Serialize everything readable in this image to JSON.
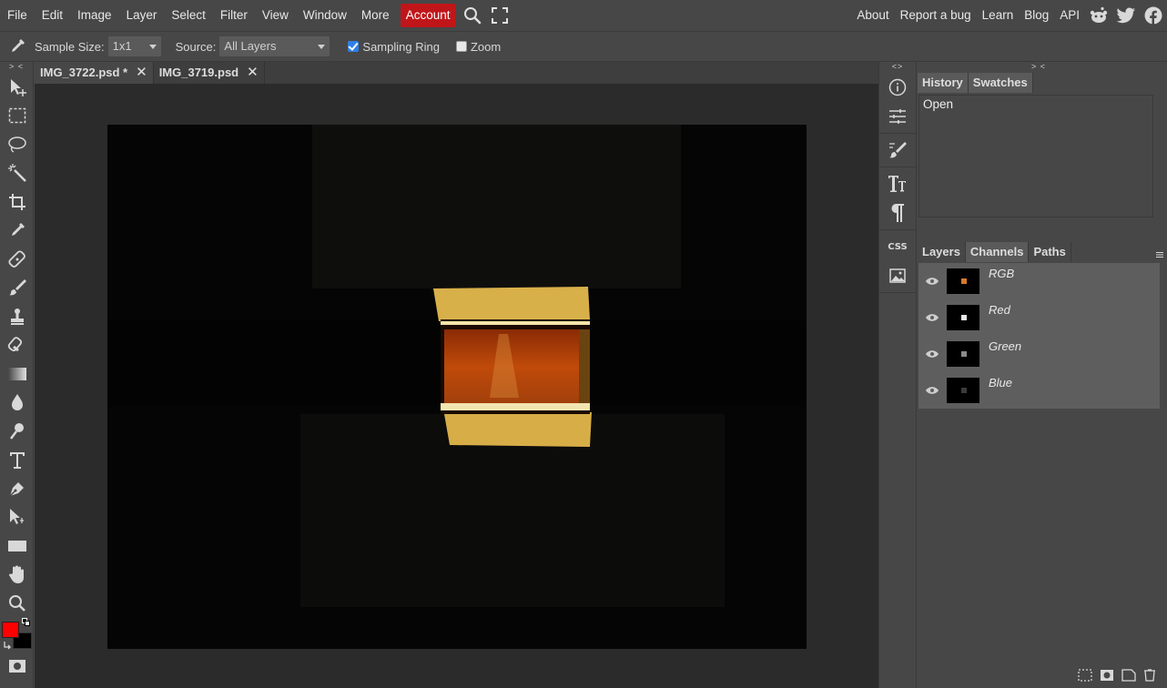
{
  "menu": {
    "items": [
      "File",
      "Edit",
      "Image",
      "Layer",
      "Select",
      "Filter",
      "View",
      "Window",
      "More"
    ],
    "account_label": "Account",
    "right_links": [
      "About",
      "Report a bug",
      "Learn",
      "Blog",
      "API"
    ],
    "accent_color": "#c0161a"
  },
  "options": {
    "sample_size_label": "Sample Size:",
    "sample_size_value": "1x1",
    "source_label": "Source:",
    "source_value": "All Layers",
    "sampling_ring_label": "Sampling Ring",
    "sampling_ring_checked": true,
    "zoom_label": "Zoom",
    "zoom_checked": false
  },
  "toolbar": {
    "collapse_mark": "> <",
    "foreground_color": "#ff0000",
    "background_color": "#000000"
  },
  "tabs": [
    {
      "label": "IMG_3722.psd *",
      "active": true
    },
    {
      "label": "IMG_3719.psd",
      "active": false
    }
  ],
  "icon_panel": {
    "collapse_mark": "<>",
    "css_label": "CSS"
  },
  "history_panel": {
    "collapse_mark": "> <",
    "tabs": [
      "History",
      "Swatches"
    ],
    "entries": [
      "Open"
    ]
  },
  "layers_panel": {
    "tabs": [
      "Layers",
      "Channels",
      "Paths"
    ],
    "active_tab": "Channels",
    "channels": [
      {
        "name": "RGB"
      },
      {
        "name": "Red"
      },
      {
        "name": "Green"
      },
      {
        "name": "Blue"
      }
    ]
  }
}
